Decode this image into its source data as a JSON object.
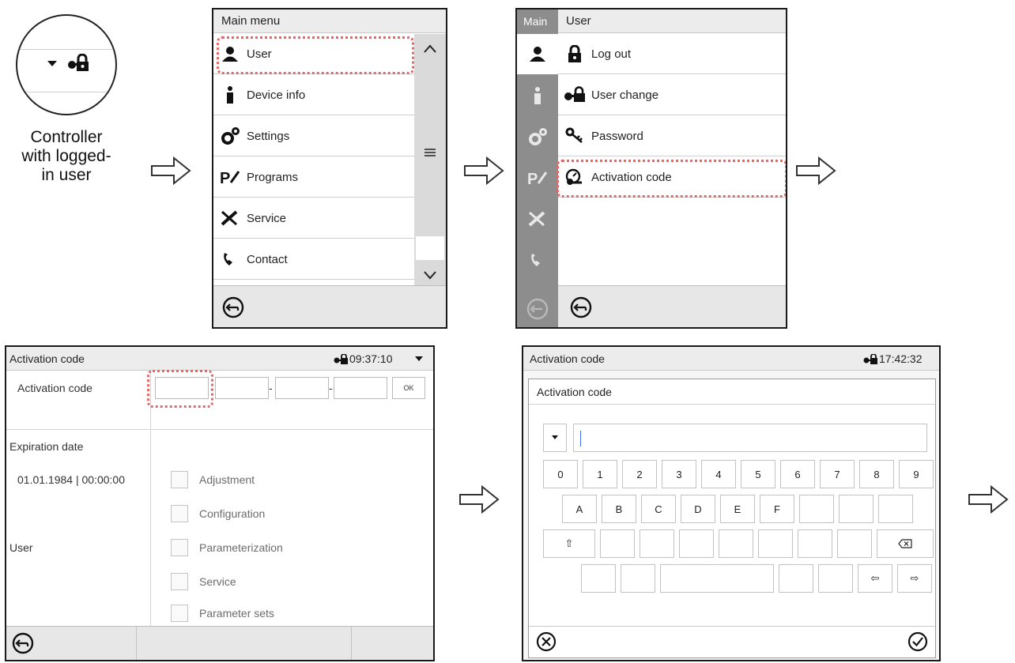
{
  "zoom": {
    "caption_lines": [
      "Controller",
      "with logged-",
      "in user"
    ]
  },
  "main_menu": {
    "title": "Main menu",
    "items": [
      {
        "label": "User",
        "icon": "user-icon"
      },
      {
        "label": "Device info",
        "icon": "info-icon"
      },
      {
        "label": "Settings",
        "icon": "gears-icon"
      },
      {
        "label": "Programs",
        "icon": "programs-icon"
      },
      {
        "label": "Service",
        "icon": "tools-icon"
      },
      {
        "label": "Contact",
        "icon": "phone-icon"
      }
    ],
    "highlighted_item": "User"
  },
  "user_menu": {
    "rail_label": "Main",
    "title": "User",
    "items": [
      {
        "label": "Log out",
        "icon": "lock-icon"
      },
      {
        "label": "User change",
        "icon": "user-key-icon"
      },
      {
        "label": "Password",
        "icon": "key-icon"
      },
      {
        "label": "Activation code",
        "icon": "activation-icon"
      }
    ],
    "highlighted_item": "Activation code"
  },
  "activation_form": {
    "title": "Activation code",
    "time": "09:37:10",
    "field_label": "Activation code",
    "separator": "-",
    "ok_label": "OK",
    "expiration_label": "Expiration date",
    "expiration_value": "01.01.1984 | 00:00:00",
    "user_label": "User",
    "permissions": [
      "Adjustment",
      "Configuration",
      "Parameterization",
      "Service",
      "Parameter sets"
    ]
  },
  "keyboard_screen": {
    "title": "Activation code",
    "time": "17:42:32",
    "dialog_title": "Activation code",
    "input_value": "",
    "row1": [
      "0",
      "1",
      "2",
      "3",
      "4",
      "5",
      "6",
      "7",
      "8",
      "9"
    ],
    "row2": [
      "A",
      "B",
      "C",
      "D",
      "E",
      "F"
    ]
  },
  "colors": {
    "highlight": "#e06a6a",
    "header_bg": "#ececec",
    "scrollbar": "#dadada"
  }
}
